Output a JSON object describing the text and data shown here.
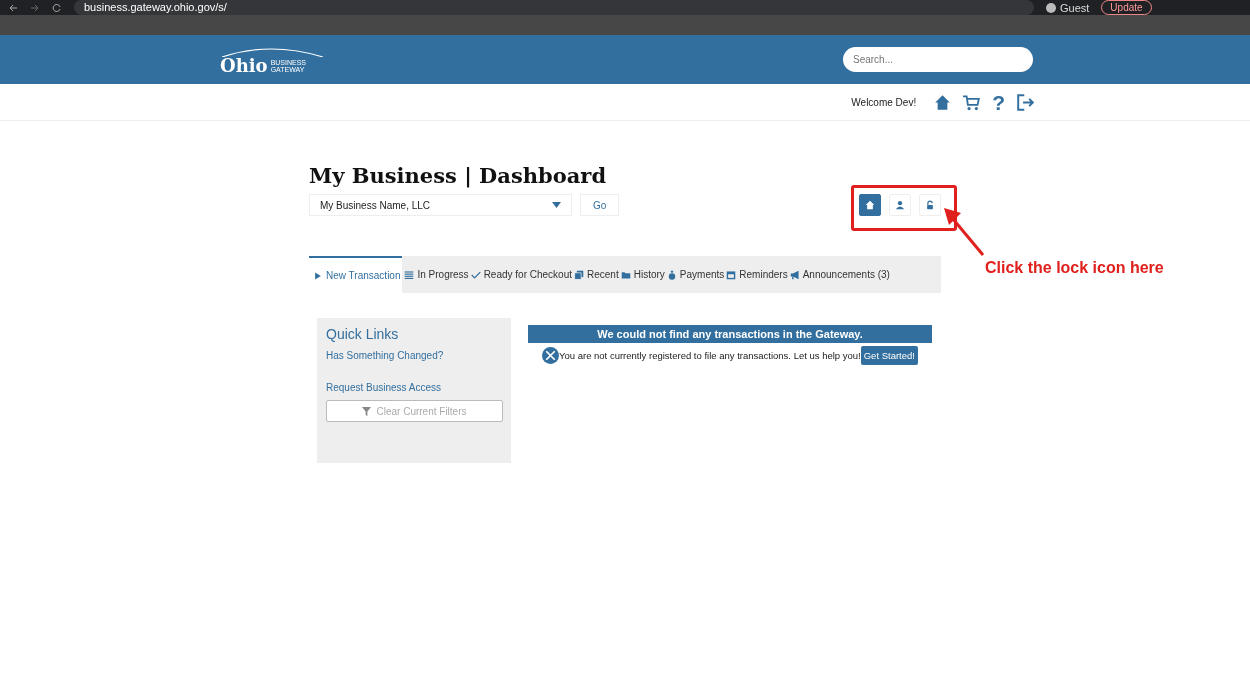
{
  "browser": {
    "url": "business.gateway.ohio.gov/s/",
    "profile": "Guest",
    "update_button": "Update"
  },
  "header": {
    "logo": {
      "word": "Ohio",
      "line_1": "BUSINESS",
      "line_2": "GATEWAY"
    },
    "search": {
      "placeholder": "Search..."
    }
  },
  "nav": {
    "welcome": "Welcome Dev!",
    "help": "?"
  },
  "page": {
    "title": "My Business | Dashboard",
    "business_select": "My Business Name, LLC",
    "go_button": "Go",
    "view_toggles": [
      {
        "kind": "home",
        "selected": true
      },
      {
        "kind": "person",
        "selected": false
      },
      {
        "kind": "lock",
        "selected": false
      }
    ]
  },
  "tabs": [
    {
      "kind": "play",
      "label": "New Transaction",
      "selected": true
    },
    {
      "kind": "list",
      "label": "In Progress",
      "selected": false
    },
    {
      "kind": "check",
      "label": "Ready for Checkout",
      "selected": false
    },
    {
      "kind": "copy",
      "label": "Recent",
      "selected": false
    },
    {
      "kind": "folder",
      "label": "History",
      "selected": false
    },
    {
      "kind": "bag",
      "label": "Payments",
      "selected": false
    },
    {
      "kind": "calendar",
      "label": "Reminders",
      "selected": false
    },
    {
      "kind": "megaphone",
      "label": "Announcements (3)",
      "selected": false
    }
  ],
  "quick_links": {
    "title": "Quick Links",
    "links": [
      "Has Something Changed?",
      "Request Business Access"
    ],
    "clear_filters_button": "Clear Current Filters"
  },
  "notice": {
    "heading": "We could not find any transactions in the Gateway.",
    "message": "You are not currently registered to file any transactions. Let us help you!",
    "button": "Get Started!"
  },
  "annotation": {
    "text": "Click the lock icon here"
  }
}
